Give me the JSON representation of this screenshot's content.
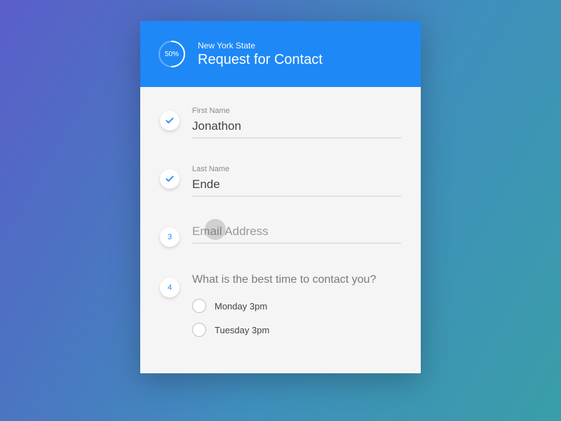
{
  "header": {
    "subtitle": "New York State",
    "title": "Request for Contact",
    "progress_percent": 50,
    "progress_label": "50%"
  },
  "fields": {
    "first_name": {
      "label": "First Name",
      "value": "Jonathon"
    },
    "last_name": {
      "label": "Last Name",
      "value": "Ende"
    },
    "email": {
      "placeholder": "Email Address",
      "step": "3"
    },
    "best_time": {
      "step": "4",
      "question": "What is the best time to contact you?",
      "options": [
        "Monday 3pm",
        "Tuesday 3pm"
      ]
    }
  }
}
